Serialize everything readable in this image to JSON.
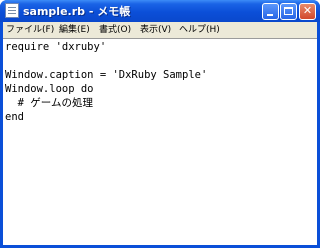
{
  "window": {
    "title": "sample.rb - メモ帳",
    "minimize_glyph": "",
    "maximize_glyph": "",
    "close_glyph": "✕"
  },
  "menu": {
    "items": [
      {
        "label": "ファイル(F)"
      },
      {
        "label": "編集(E)"
      },
      {
        "label": "書式(O)"
      },
      {
        "label": "表示(V)"
      },
      {
        "label": "ヘルプ(H)"
      }
    ]
  },
  "editor": {
    "lines": [
      "require 'dxruby'",
      "",
      "Window.caption = 'DxRuby Sample'",
      "Window.loop do",
      "  # ゲームの処理",
      "end"
    ]
  },
  "icons": {
    "app": "notepad-icon",
    "minimize": "minimize-icon",
    "maximize": "maximize-icon",
    "close": "close-icon"
  },
  "colors": {
    "titlebar": "#0b4fd8",
    "menubar": "#ece9d8",
    "close_button": "#d2482c"
  }
}
